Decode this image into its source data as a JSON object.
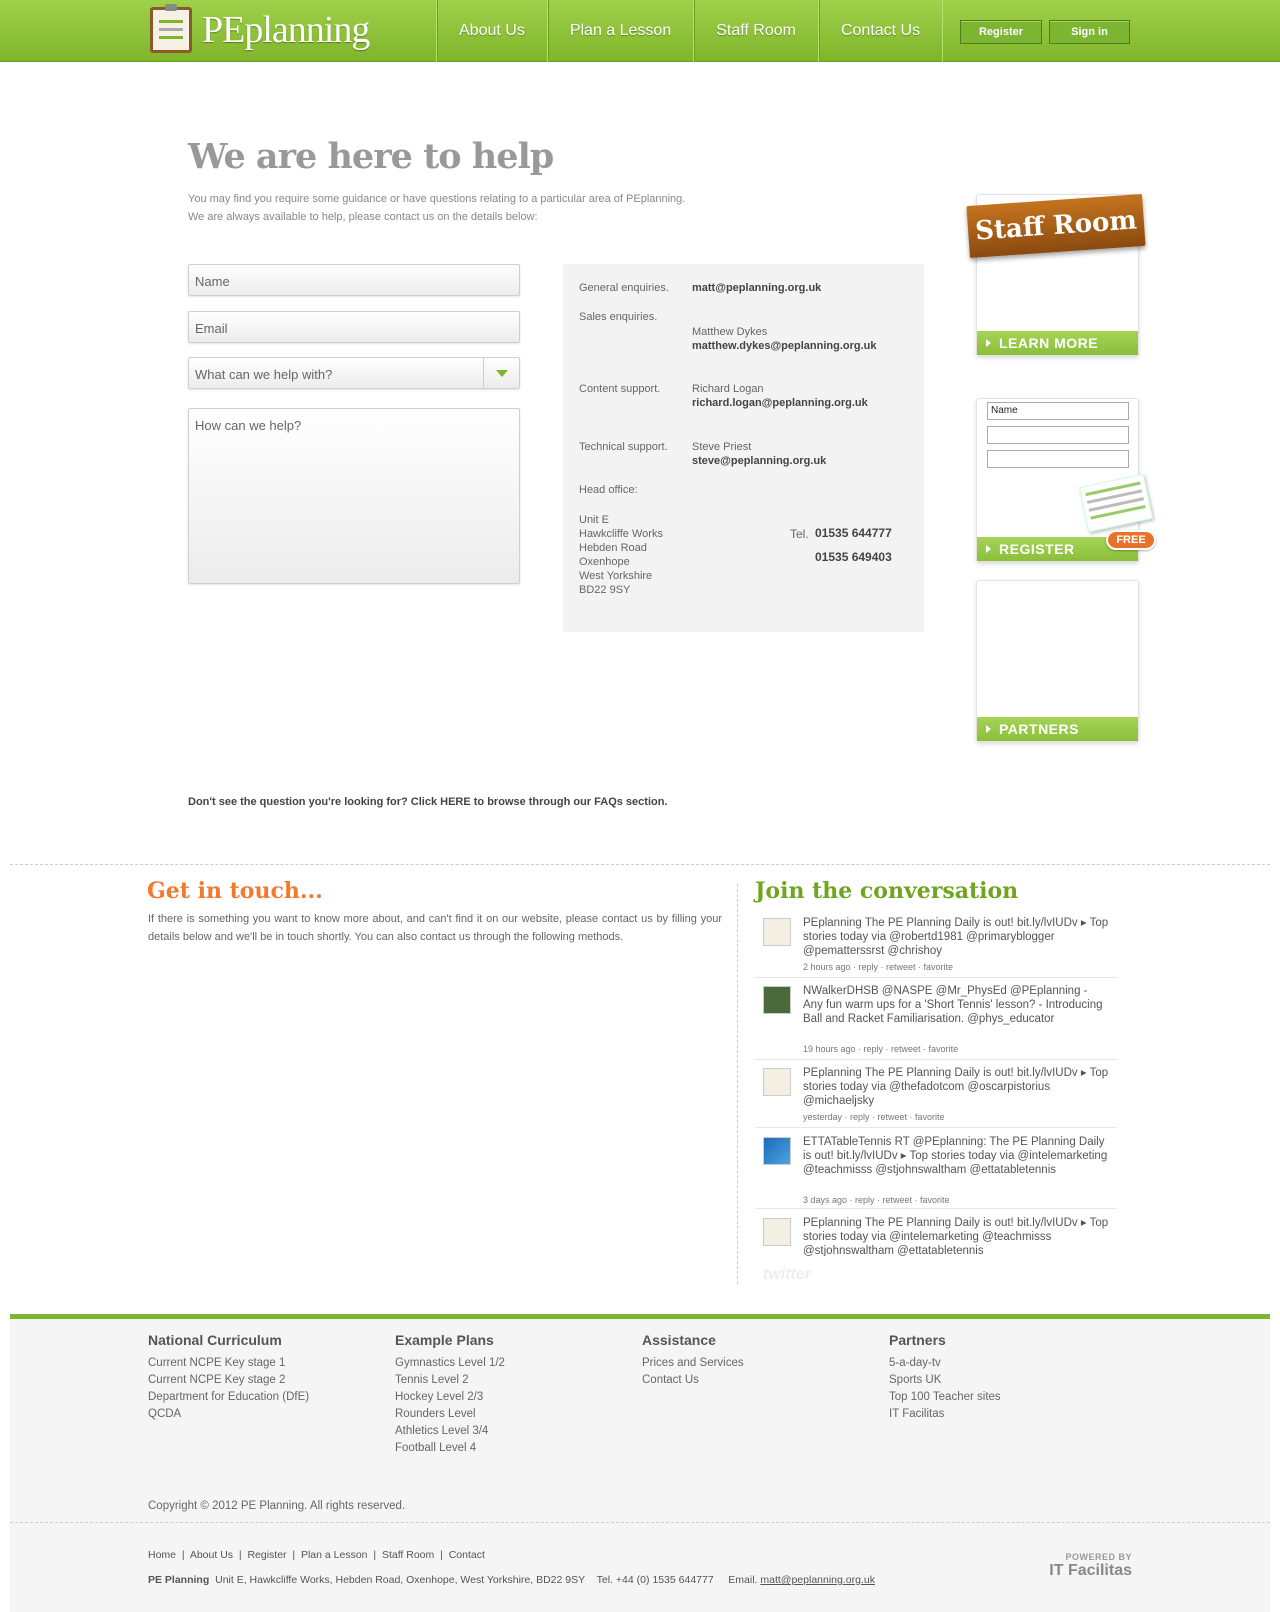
{
  "header": {
    "logo_text": "PEplanning",
    "nav": [
      "About Us",
      "Plan a Lesson",
      "Staff Room",
      "Contact Us"
    ],
    "register_label": "Register",
    "signin_label": "Sign in"
  },
  "main": {
    "title": "We are here to help",
    "intro_line1": "You may find you require some guidance or have questions relating to a particular area of PEplanning.",
    "intro_line2": "We are always available to help, please contact us on the details below:"
  },
  "form": {
    "name_placeholder": "Name",
    "email_placeholder": "Email",
    "topic_placeholder": "What can we help with?",
    "message_placeholder": "How can we help?"
  },
  "contact": {
    "general_label": "General enquiries.",
    "general_email": "matt@peplanning.org.uk",
    "sales_label": "Sales enquiries.",
    "sales_name": "Matthew Dykes",
    "sales_email": "matthew.dykes@peplanning.org.uk",
    "content_label": "Content support.",
    "content_name": "Richard Logan",
    "content_email": "richard.logan@peplanning.org.uk",
    "tech_label": "Technical support.",
    "tech_name": "Steve Priest",
    "tech_email": "steve@peplanning.org.uk",
    "office_label": "Head office:",
    "address": [
      "Unit E",
      "Hawkcliffe Works",
      "Hebden Road",
      "Oxenhope",
      "West Yorkshire",
      "BD22 9SY"
    ],
    "tel_label": "Tel.",
    "tel1": "01535 644777",
    "tel2": "01535 649403"
  },
  "sidebar": {
    "staff_banner": "Staff Room",
    "learn_more": "LEARN MORE",
    "mini_name": "Name",
    "register": "REGISTER",
    "free": "FREE",
    "partners": "PARTNERS"
  },
  "faq_text": "Don't see the question you're looking for? Click HERE to browse through our FAQs section.",
  "get_in_touch": {
    "title": "Get in touch...",
    "text": "If there is something you want to know more about, and can't find it on our website, please contact us by filling your details below and we'll be in touch shortly. You can also contact us through the following methods."
  },
  "conversation": {
    "title": "Join the conversation",
    "tweets": [
      {
        "text": "PEplanning The PE Planning Daily is out! bit.ly/lvIUDv ▸ Top stories today via @robertd1981 @primaryblogger @pematterssrst @chrishoy",
        "meta": "2 hours ago · reply · retweet · favorite"
      },
      {
        "text": "NWalkerDHSB @NASPE @Mr_PhysEd @PEplanning - Any fun warm ups for a 'Short Tennis' lesson? - Introducing Ball and Racket Familiarisation. @phys_educator",
        "meta": "19 hours ago · reply · retweet · favorite"
      },
      {
        "text": "PEplanning The PE Planning Daily is out! bit.ly/lvIUDv ▸ Top stories today via @thefadotcom @oscarpistorius @michaeljsky",
        "meta": "yesterday · reply · retweet · favorite"
      },
      {
        "text": "ETTATableTennis RT @PEplanning: The PE Planning Daily is out! bit.ly/lvIUDv ▸ Top stories today via @intelemarketing @teachmisss @stjohnswaltham @ettatabletennis",
        "meta": "3 days ago · reply · retweet · favorite"
      },
      {
        "text": "PEplanning The PE Planning Daily is out! bit.ly/lvIUDv ▸ Top stories today via @intelemarketing @teachmisss @stjohnswaltham @ettatabletennis",
        "meta": ""
      }
    ],
    "twitter_label": "twitter"
  },
  "footer": {
    "cols": [
      {
        "title": "National Curriculum",
        "links": [
          "Current NCPE Key stage 1",
          "Current NCPE Key stage 2",
          "Department for Education (DfE)",
          "QCDA"
        ]
      },
      {
        "title": "Example Plans",
        "links": [
          "Gymnastics Level 1/2",
          "Tennis Level 2",
          "Hockey Level 2/3",
          "Rounders Level",
          "Athletics Level 3/4",
          "Football Level 4"
        ]
      },
      {
        "title": "Assistance",
        "links": [
          "Prices and Services",
          "Contact Us"
        ]
      },
      {
        "title": "Partners",
        "links": [
          "5-a-day-tv",
          "Sports UK",
          "Top 100 Teacher sites",
          "IT Facilitas"
        ]
      }
    ],
    "copyright": "Copyright © 2012 PE Planning. All rights reserved.",
    "nav": [
      "Home",
      "About Us",
      "Register",
      "Plan a Lesson",
      "Staff Room",
      "Contact"
    ],
    "company": "PE Planning",
    "address_line": "Unit E, Hawkcliffe Works, Hebden Road, Oxenhope, West Yorkshire, BD22 9SY",
    "tel": "Tel. +44 (0) 1535 644777",
    "email_label": "Email.",
    "email": "matt@peplanning.org.uk",
    "powered_by": "POWERED BY",
    "powered_name": "IT Facilitas"
  },
  "colors": {
    "brand_green": "#7cb531",
    "accent_orange": "#f07a2e",
    "title_grey": "#999999"
  }
}
